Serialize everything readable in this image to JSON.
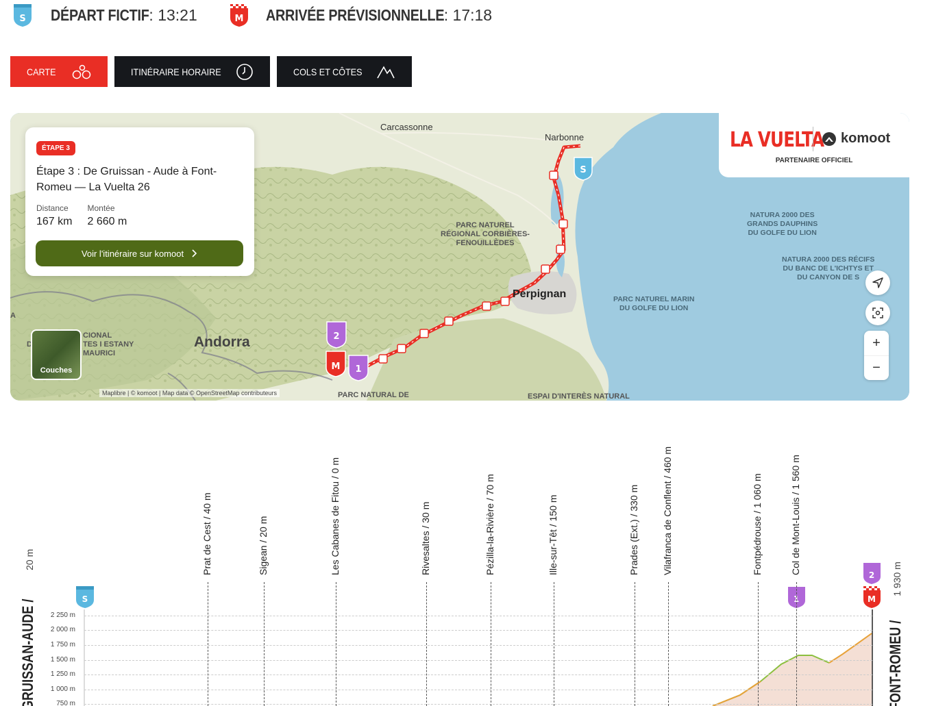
{
  "header": {
    "start_icon": "S",
    "start_label": "DÉPART FICTIF",
    "start_time": " : 13:21",
    "arrival_icon": "M",
    "arrival_label": "ARRIVÉE PRÉVISIONNELLE",
    "arrival_time": " : 17:18"
  },
  "tabs": [
    {
      "label": "CARTE",
      "icon": "bike-icon",
      "active": true
    },
    {
      "label": "ITINÉRAIRE HORAIRE",
      "icon": "clock-icon",
      "active": false
    },
    {
      "label": "COLS ET CÔTES",
      "icon": "mountain-icon",
      "active": false
    }
  ],
  "map": {
    "card": {
      "badge": "ÉTAPE 3",
      "title": "Étape 3 : De Gruissan - Aude à Font-Romeu — La Vuelta 26",
      "distance_label": "Distance",
      "distance_value": "167 km",
      "climb_label": "Montée",
      "climb_value": "2 660 m",
      "button_label": "Voir l'itinéraire sur komoot"
    },
    "partner": {
      "brand": "LA VUELTA",
      "partner_brand": "komoot",
      "subtitle": "PARTENAIRE OFFICIEL"
    },
    "labels": {
      "carcassonne": "Carcassonne",
      "narbonne": "Narbonne",
      "perpignan": "Perpignan",
      "andorra": "Andorra",
      "parc_corbieres": "PARC NATUREL\nRÉGIONAL CORBIÈRES-\nFENOUILLÈDES",
      "natura_dauphins": "NATURA 2000 DES\nGRANDS DAUPHINS\nDU GOLFE DU LION",
      "natura_recifs": "NATURA 2000 DES RÉCIFS\nDU BANC DE L'ICHTYS ET\nDU CANYON DE S",
      "parc_marin": "PARC NATUREL MARIN\nDU GOLFE DU LION",
      "parcnatural": "PARC NATURAL DE",
      "espai": "ESPAI D'INTERÈS NATURAL",
      "cional": "CIONAL\nTES I ESTANY\nMAURICI",
      "d_left": "D",
      "a_left": "A"
    },
    "layers_label": "Couches",
    "attribution": "Maplibre | © komoot | Map data © OpenStreetMap contributeurs",
    "zoom_in": "+",
    "zoom_out": "−",
    "markers": {
      "start": "S",
      "finish": "M",
      "climb1": "1",
      "climb2": "2"
    }
  },
  "profile": {
    "start_label": "GRUISSAN-AUDE /",
    "start_alt": "20 m",
    "end_label": "FONT-ROMEU /",
    "end_alt": "1 930 m",
    "start_marker": "S",
    "finish_marker": "M",
    "climb_markers": [
      "1",
      "2"
    ],
    "y_ticks": [
      "2 250 m",
      "2 000 m",
      "1 750 m",
      "1 500 m",
      "1 250 m",
      "1 000 m",
      "750 m"
    ],
    "waypoints": [
      {
        "name": "Prat de Cest",
        "alt": " / 40 m"
      },
      {
        "name": "Sigean",
        "alt": " / 20 m"
      },
      {
        "name": "Les Cabanes de Fitou",
        "alt": " / 0 m"
      },
      {
        "name": "Rivesaltes",
        "alt": " / 30 m"
      },
      {
        "name": "Pézilla-la-Rivière",
        "alt": " / 70 m"
      },
      {
        "name": "Ille-sur-Têt",
        "alt": " / 150 m"
      },
      {
        "name": "Prades (Ext.)",
        "alt": " / 330 m"
      },
      {
        "name": "Vilafranca de Conflent",
        "alt": " / 460 m"
      },
      {
        "name": "Fontpédrouse",
        "alt": " / 1 060 m"
      },
      {
        "name": "Col de Mont-Louis",
        "alt": " / 1 560 m"
      }
    ]
  },
  "colors": {
    "accent": "#e92e25",
    "dark": "#16181c",
    "komoot_green": "#4f6a17",
    "start_blue": "#5bb8e0",
    "climb_purple": "#b067d8"
  }
}
